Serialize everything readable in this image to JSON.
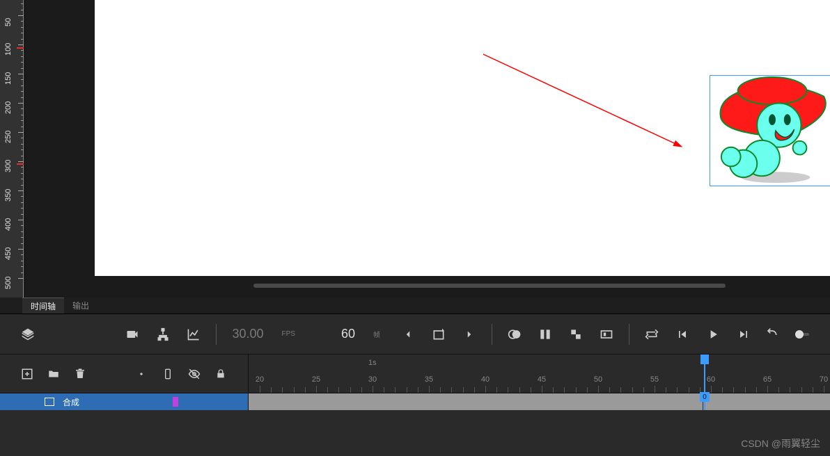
{
  "ruler_v": {
    "labels": [
      "50",
      "100",
      "150",
      "200",
      "250",
      "300",
      "350",
      "400",
      "450",
      "500"
    ]
  },
  "tabs": {
    "timeline": "时间轴",
    "output": "输出"
  },
  "toolbar": {
    "fps_value": "30.00",
    "fps_label": "FPS",
    "frame_value": "60",
    "frame_label": "帧"
  },
  "time_ruler": {
    "second_marker": "1s",
    "ticks": [
      "20",
      "25",
      "30",
      "35",
      "40",
      "45",
      "50",
      "55",
      "60",
      "65",
      "70"
    ]
  },
  "track": {
    "name": "合成",
    "playhead_frame": "0"
  },
  "watermark": "CSDN @雨翼轻尘"
}
